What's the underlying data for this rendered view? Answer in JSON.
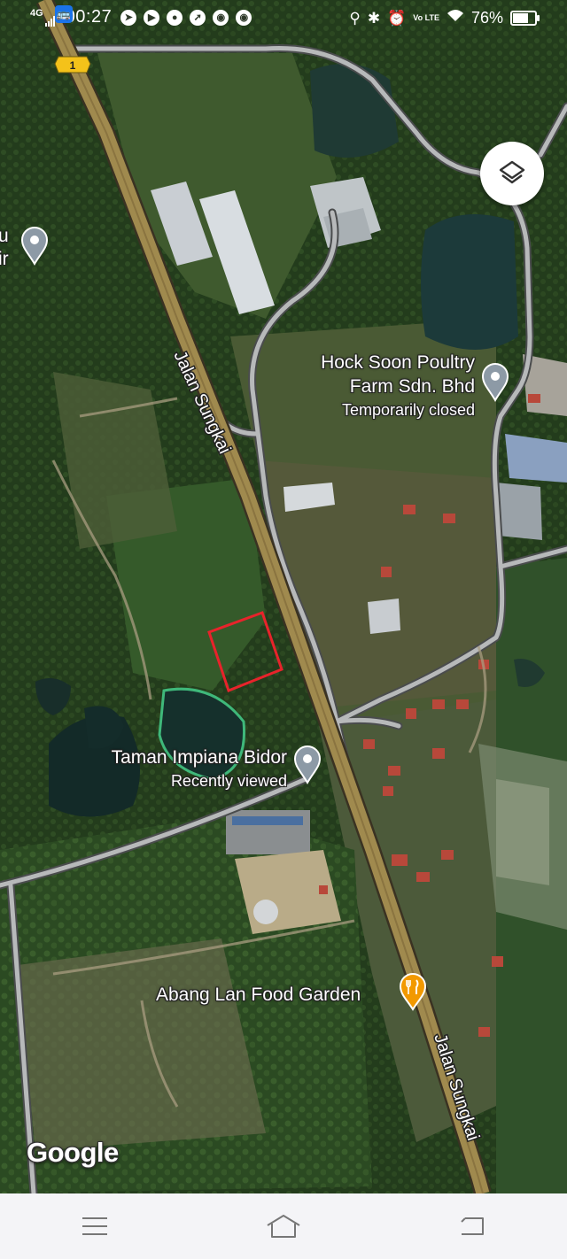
{
  "status_bar": {
    "network": "4G",
    "time": "00:27",
    "volte": "Vo LTE",
    "battery_percent": "76%",
    "battery_level": 0.76
  },
  "map": {
    "route_shield": "1",
    "road_labels": [
      "Jalan Sungkai",
      "Jalan Sungkai"
    ],
    "clipped_label": [
      "u",
      "ir"
    ],
    "places": [
      {
        "name_lines": [
          "Hock Soon Poultry",
          "Farm Sdn. Bhd"
        ],
        "status": "Temporarily closed",
        "icon": "pin-icon"
      },
      {
        "name_lines": [
          "Taman Impiana Bidor"
        ],
        "status": "Recently viewed",
        "icon": "pin-icon"
      },
      {
        "name_lines": [
          "Abang Lan Food Garden"
        ],
        "status": "",
        "icon": "restaurant-pin-icon"
      }
    ],
    "marked_parcel": {
      "color": "#e8232b"
    },
    "attribution": "Google"
  },
  "controls": {
    "layers_icon": "layers-icon"
  },
  "nav_bar": {
    "items": [
      "menu-icon",
      "home-icon",
      "back-icon"
    ]
  }
}
